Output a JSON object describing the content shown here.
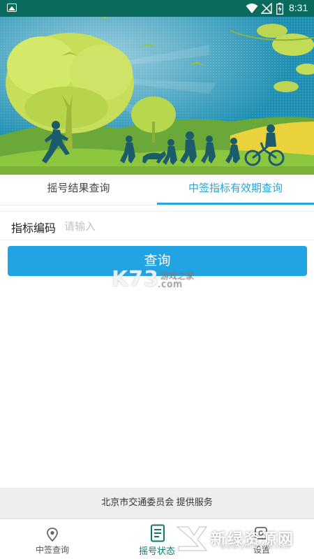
{
  "status_bar": {
    "time": "8:31",
    "icons": [
      "gallery-icon",
      "wifi-icon",
      "no-signal-icon",
      "battery-charging-icon"
    ]
  },
  "banner": {
    "image": "illustration-people-running-trees-cyclist",
    "colors": {
      "sky": "#1f93b5",
      "grass": "#8cc63f",
      "tree": "#c5e05b"
    }
  },
  "tabs": [
    {
      "label": "摇号结果查询",
      "active": false
    },
    {
      "label": "中签指标有效期查询",
      "active": true
    }
  ],
  "form": {
    "label": "指标编码",
    "placeholder": "请输入",
    "value": ""
  },
  "query_button": {
    "label": "查询"
  },
  "watermark_k73": {
    "main": "K73",
    "sub": "游戏之家",
    "domain": ".com"
  },
  "provider_text": "北京市交通委员会 提供服务",
  "bottom_nav": [
    {
      "label": "中签查询",
      "icon": "map-pin-icon",
      "active": false
    },
    {
      "label": "摇号状态",
      "icon": "document-list-icon",
      "active": true
    },
    {
      "label": "设置",
      "icon": "settings-icon",
      "active": false
    }
  ],
  "watermark_xinlv": {
    "main": "新绿资源网",
    "sub": "www.xinlvzyw.com"
  },
  "accent_color": "#21a4e4",
  "theme_color": "#0a6a5b"
}
